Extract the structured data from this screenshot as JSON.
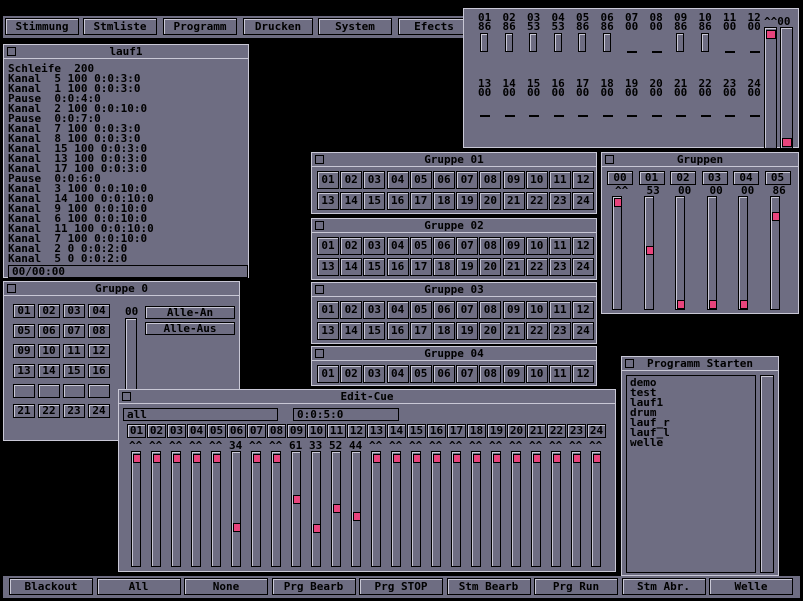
{
  "menu": [
    "Stimmung",
    "Stmliste",
    "Programm",
    "Drucken",
    "System",
    "Efects"
  ],
  "lauf1": {
    "title": "lauf1",
    "lines": [
      "Schleife  200",
      "Kanal  5 100 0:0:3:0",
      "Kanal  1 100 0:0:3:0",
      "Pause  0:0:4:0",
      "Kanal  2 100 0:0:10:0",
      "Pause  0:0:7:0",
      "Kanal  7 100 0:0:3:0",
      "Kanal  8 100 0:0:3:0",
      "Kanal  15 100 0:0:3:0",
      "Kanal  13 100 0:0:3:0",
      "Kanal  17 100 0:0:3:0",
      "Pause  0:0:6:0",
      "Kanal  3 100 0:0:10:0",
      "Kanal  14 100 0:0:10:0",
      "Kanal  9 100 0:0:10:0",
      "Kanal  6 100 0:0:10:0",
      "Kanal  11 100 0:0:10:0",
      "Kanal  7 100 0:0:10:0",
      "Kanal  2 0 0:0:2:0",
      "Kanal  5 0 0:0:2:0"
    ],
    "status": "00/00:00"
  },
  "top_panel": {
    "row1_labels": [
      "01",
      "02",
      "03",
      "04",
      "05",
      "06",
      "07",
      "08",
      "09",
      "10",
      "11",
      "12"
    ],
    "row1_values": [
      "86",
      "86",
      "53",
      "53",
      "86",
      "86",
      "00",
      "00",
      "86",
      "86",
      "00",
      "00"
    ],
    "row2_labels": [
      "13",
      "14",
      "15",
      "16",
      "17",
      "18",
      "19",
      "20",
      "21",
      "22",
      "23",
      "24"
    ],
    "row2_values": [
      "00",
      "00",
      "00",
      "00",
      "00",
      "00",
      "00",
      "00",
      "00",
      "00",
      "00",
      "00"
    ],
    "side_label": "^^00"
  },
  "gruppen": [
    {
      "title": "Gruppe 01"
    },
    {
      "title": "Gruppe 02"
    },
    {
      "title": "Gruppe 03"
    },
    {
      "title": "Gruppe 04"
    }
  ],
  "nums": [
    "01",
    "02",
    "03",
    "04",
    "05",
    "06",
    "07",
    "08",
    "09",
    "10",
    "11",
    "12",
    "13",
    "14",
    "15",
    "16",
    "17",
    "18",
    "19",
    "20",
    "21",
    "22",
    "23",
    "24"
  ],
  "gruppe0": {
    "title": "Gruppe 0",
    "cells": [
      "01",
      "02",
      "03",
      "04",
      "05",
      "06",
      "07",
      "08",
      "09",
      "10",
      "11",
      "12",
      "13",
      "14",
      "15",
      "16",
      "",
      "",
      "",
      "",
      "21",
      "22",
      "23",
      "24"
    ],
    "value": "00",
    "alle_an": "Alle-An",
    "alle_aus": "Alle-Aus"
  },
  "gruppen_panel": {
    "title": "Gruppen",
    "labels": [
      "00",
      "01",
      "02",
      "03",
      "04",
      "05"
    ],
    "values": [
      "^^",
      "53",
      "00",
      "00",
      "00",
      "86"
    ],
    "levels": [
      1.0,
      0.53,
      0,
      0,
      0,
      0.86
    ]
  },
  "programm": {
    "title": "Programm Starten",
    "items": [
      "demo",
      "test",
      "lauf1",
      "drum",
      "lauf_r",
      "lauf_l",
      "welle"
    ]
  },
  "editcue": {
    "title": "Edit-Cue",
    "field1": "all",
    "field2": "0:0:5:0",
    "channels": [
      "01",
      "02",
      "03",
      "04",
      "05",
      "06",
      "07",
      "08",
      "09",
      "10",
      "11",
      "12",
      "13",
      "14",
      "15",
      "16",
      "17",
      "18",
      "19",
      "20",
      "21",
      "22",
      "23",
      "24"
    ],
    "values": [
      "^^",
      "^^",
      "^^",
      "^^",
      "^^",
      "34",
      "^^",
      "^^",
      "61",
      "33",
      "52",
      "44",
      "^^",
      "^^",
      "^^",
      "^^",
      "^^",
      "^^",
      "^^",
      "^^",
      "^^",
      "^^",
      "^^",
      "^^"
    ],
    "levels": [
      1,
      1,
      1,
      1,
      1,
      0.34,
      1,
      1,
      0.61,
      0.33,
      0.52,
      0.44,
      1,
      1,
      1,
      1,
      1,
      1,
      1,
      1,
      1,
      1,
      1,
      1
    ]
  },
  "bottom": [
    "Blackout",
    "All",
    "None",
    "Prg Bearb",
    "Prg STOP",
    "Stm Bearb",
    "Prg Run",
    "Stm Abr.",
    "Welle"
  ]
}
